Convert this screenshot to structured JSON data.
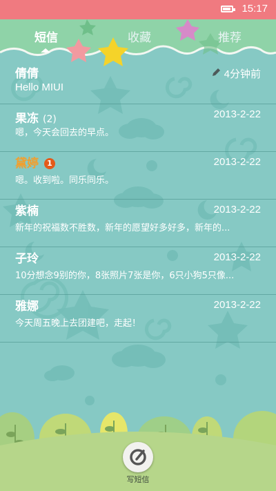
{
  "status_bar": {
    "time": "15:17",
    "battery_icon": "battery-icon"
  },
  "tabs": [
    {
      "label": "短信",
      "active": true
    },
    {
      "label": "收藏",
      "active": false
    },
    {
      "label": "推荐",
      "active": false
    }
  ],
  "conversations": [
    {
      "name": "倩倩",
      "count": "",
      "date": "4分钟前",
      "preview": "Hello MIUI",
      "draft_icon": "pencil-icon"
    },
    {
      "name": "果冻",
      "count": "(2)",
      "date": "2013-2-22",
      "preview": "嗯，今天会回去的早点。"
    },
    {
      "name": "黛婷",
      "badge": "1",
      "date": "2013-2-22",
      "preview": "嗯。收到啦。同乐同乐。",
      "name_color": "#f0a030"
    },
    {
      "name": "紫楠",
      "count": "",
      "date": "2013-2-22",
      "preview": "新年的祝福数不胜数，新年的愿望好多好多，新年的..."
    },
    {
      "name": "子玲",
      "count": "",
      "date": "2013-2-22",
      "preview": "10分想念9别的你，8张照片7张是你，6只小狗5只像..."
    },
    {
      "name": "雅娜",
      "count": "",
      "date": "2013-2-22",
      "preview": "今天周五晚上去团建吧，走起！"
    }
  ],
  "compose": {
    "label": "写短信",
    "icon": "compose-icon"
  },
  "colors": {
    "status_bar": "#f07a80",
    "header": "#8fd3a8",
    "background": "#86c9c4",
    "hill": "#b6d68a",
    "unread_name": "#f0a030",
    "badge": "#e45a1a"
  }
}
